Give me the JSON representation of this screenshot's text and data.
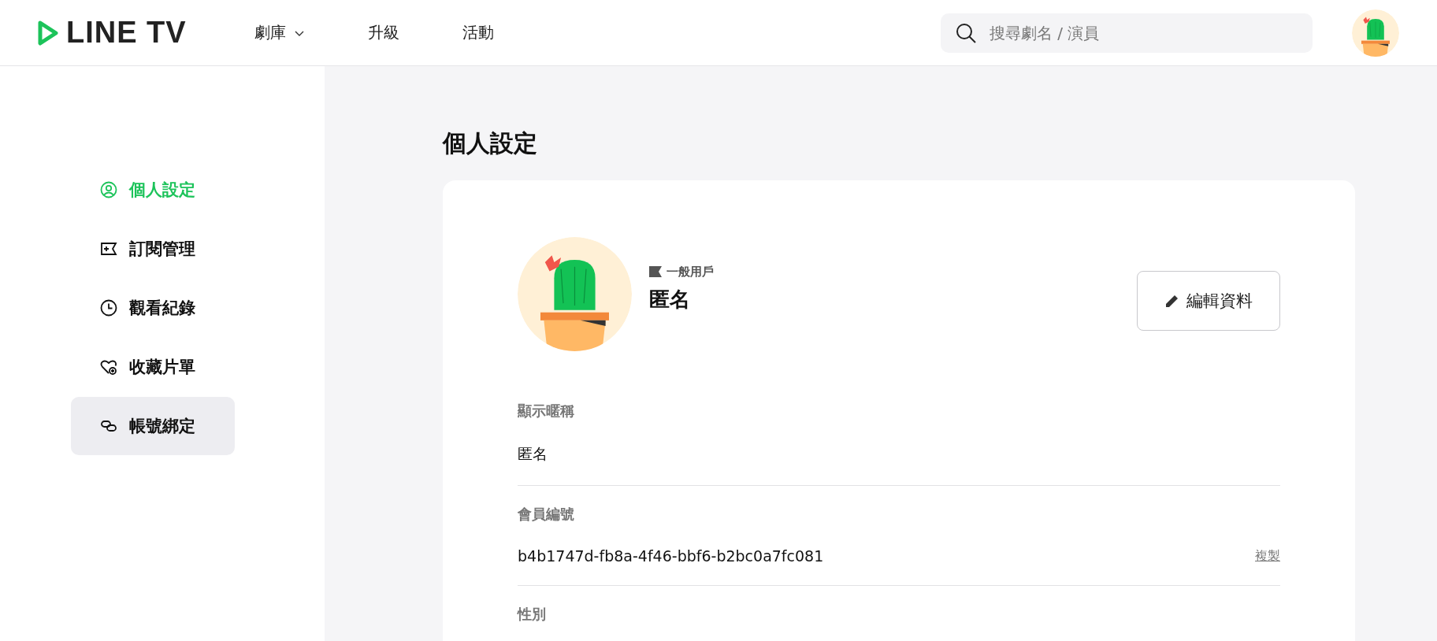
{
  "header": {
    "logo": "LINE TV",
    "nav": [
      {
        "label": "劇庫",
        "dropdown": true
      },
      {
        "label": "升級",
        "dropdown": false
      },
      {
        "label": "活動",
        "dropdown": false
      }
    ],
    "search": {
      "placeholder": "搜尋劇名 / 演員"
    }
  },
  "sidebar": {
    "items": [
      {
        "kind": "person",
        "label": "個人設定",
        "selected": true,
        "highlighted": false
      },
      {
        "kind": "ticket",
        "label": "訂閱管理",
        "selected": false,
        "highlighted": false
      },
      {
        "kind": "clock",
        "label": "觀看紀錄",
        "selected": false,
        "highlighted": false
      },
      {
        "kind": "heart",
        "label": "收藏片單",
        "selected": false,
        "highlighted": false
      },
      {
        "kind": "link",
        "label": "帳號綁定",
        "selected": false,
        "highlighted": true
      }
    ]
  },
  "page_title": "個人設定",
  "profile": {
    "badge": "一般用戶",
    "name": "匿名",
    "edit_button": "編輯資料",
    "fields": [
      {
        "label": "顯示暱稱",
        "value": "匿名"
      },
      {
        "label": "會員編號",
        "value": "b4b1747d-fb8a-4f46-bbf6-b2bc0a7fc081",
        "action": "複製"
      },
      {
        "label": "性別"
      }
    ]
  }
}
